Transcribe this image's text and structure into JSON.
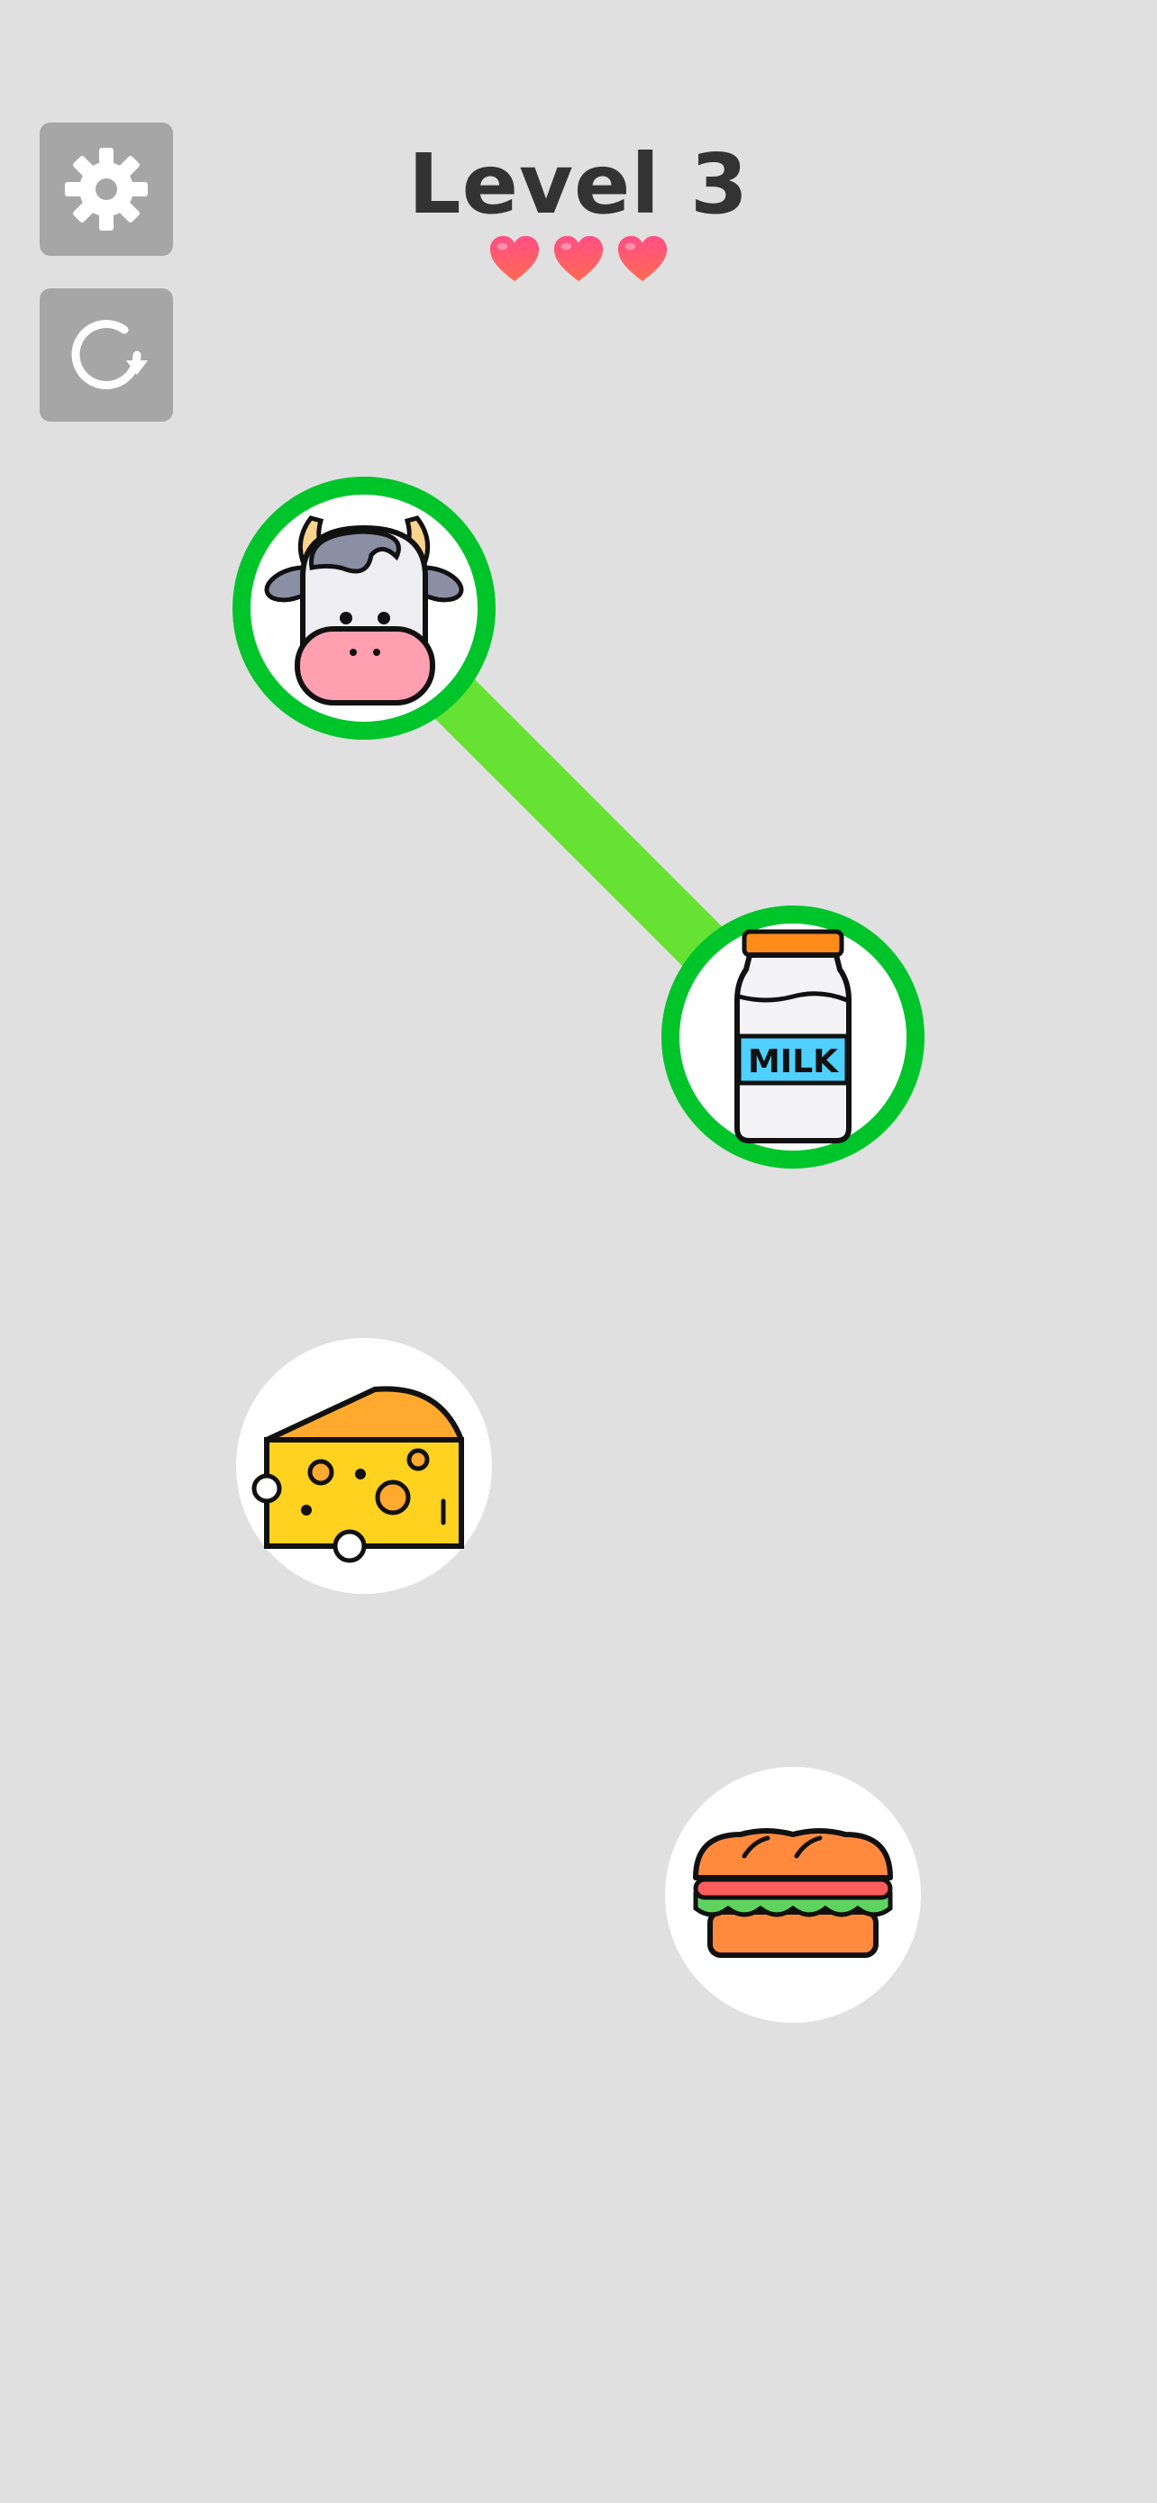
{
  "header": {
    "level_label": "Level 3",
    "lives": 3
  },
  "controls": {
    "settings_icon": "gear-icon",
    "restart_icon": "restart-icon"
  },
  "items": [
    {
      "id": "cow",
      "icon": "cow-icon",
      "selected": true
    },
    {
      "id": "milk",
      "icon": "milk-bottle-icon",
      "label": "MILK",
      "selected": true
    },
    {
      "id": "cheese",
      "icon": "cheese-icon",
      "selected": false
    },
    {
      "id": "sandwich",
      "icon": "sandwich-icon",
      "selected": false
    }
  ],
  "connections": [
    {
      "from": "cow",
      "to": "milk"
    }
  ],
  "colors": {
    "background": "#e0e0e0",
    "button": "#a6a6a6",
    "title": "#333333",
    "heart": "#ff4f7a",
    "selected_ring": "#00c52a",
    "connection_line": "#66e332",
    "node_fill": "#ffffff"
  }
}
